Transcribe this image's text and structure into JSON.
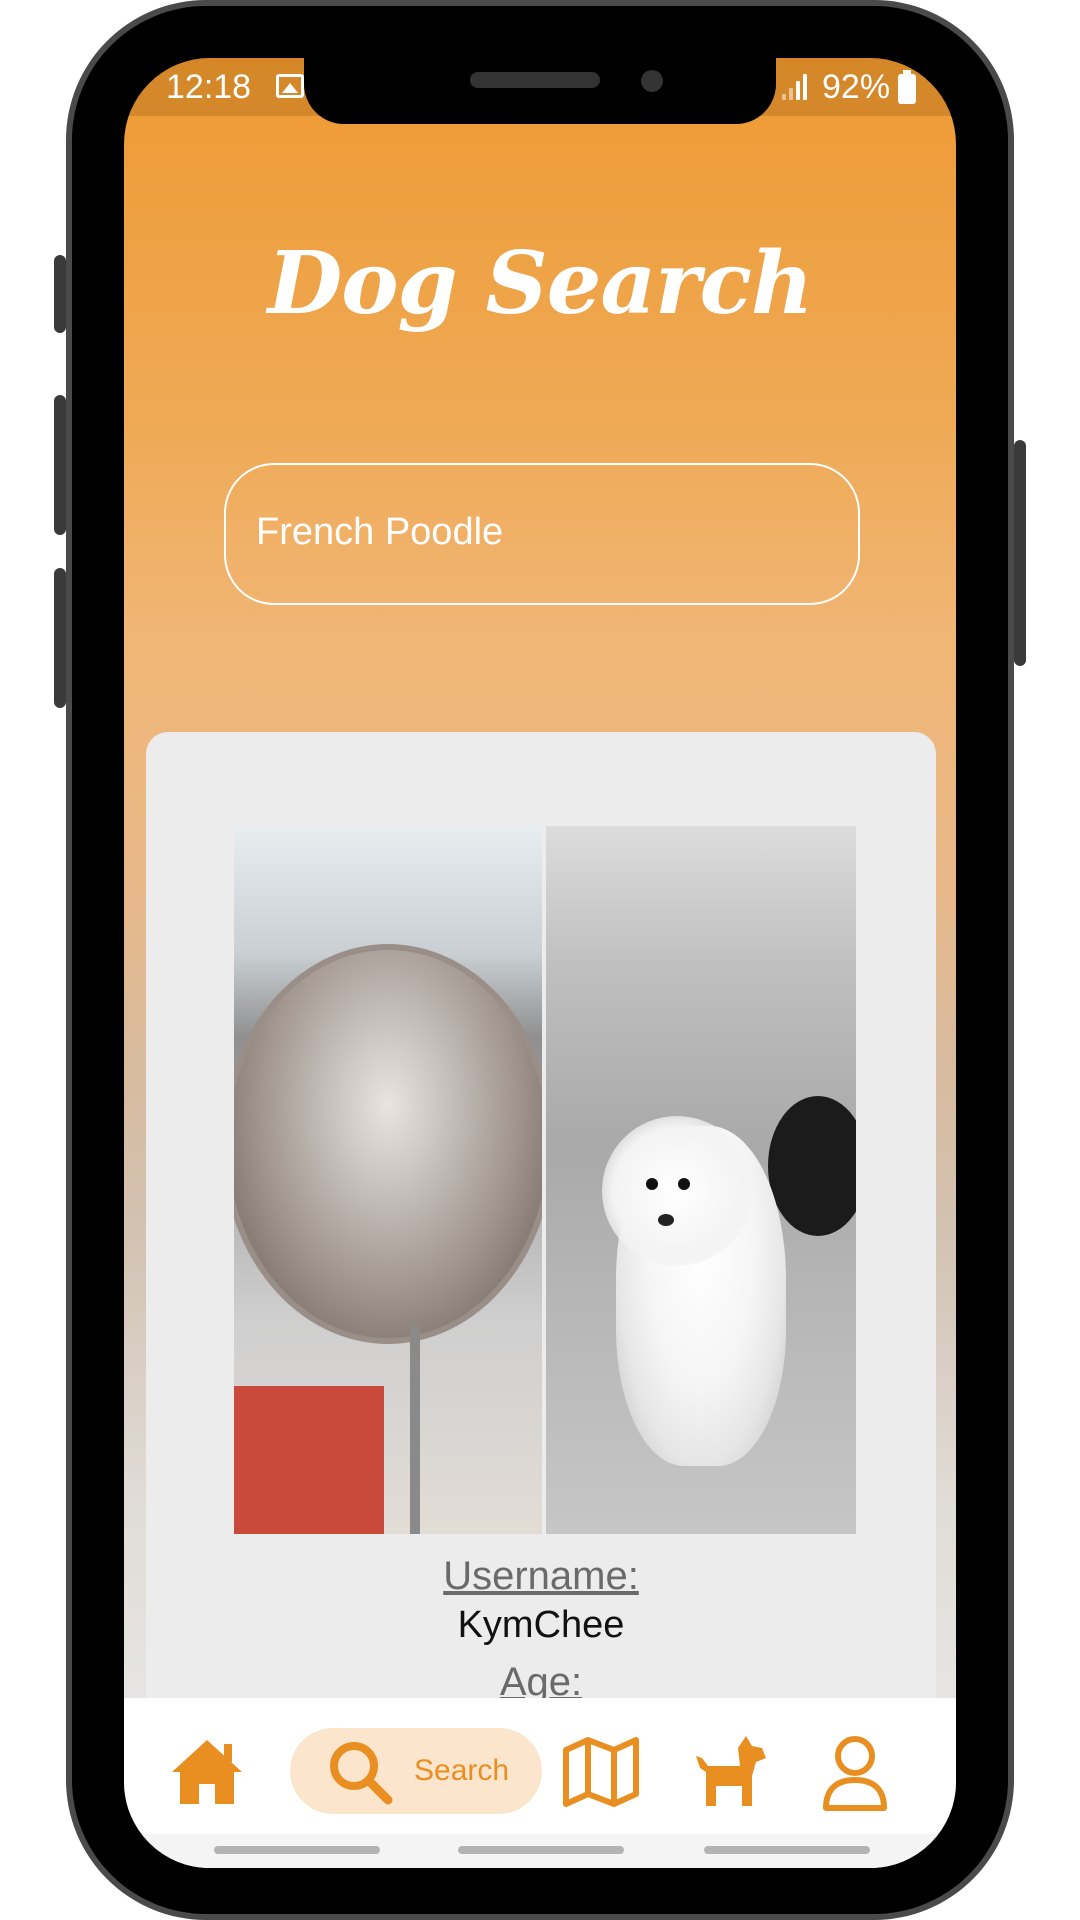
{
  "status_bar": {
    "time": "12:18",
    "battery": "92%"
  },
  "header": {
    "title": "Dog Search"
  },
  "search": {
    "value": "French Poodle"
  },
  "result_card": {
    "username_label": "Username:",
    "username_value": "KymChee",
    "age_label": "Age:"
  },
  "bottom_nav": {
    "items": [
      {
        "icon": "home-icon",
        "label": ""
      },
      {
        "icon": "search-icon",
        "label": "Search",
        "active": true
      },
      {
        "icon": "map-icon",
        "label": ""
      },
      {
        "icon": "dog-icon",
        "label": ""
      },
      {
        "icon": "profile-icon",
        "label": ""
      }
    ]
  },
  "colors": {
    "accent": "#e98f22",
    "header_top": "#ee9a33",
    "active_nav_bg": "#fbe5cc",
    "card_bg": "#ececec"
  }
}
